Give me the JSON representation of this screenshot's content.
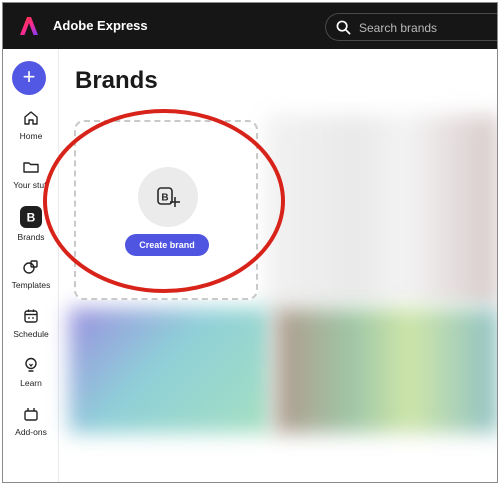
{
  "app": {
    "title": "Adobe Express",
    "brand_color": "#ff1a1a"
  },
  "search": {
    "placeholder": "Search brands"
  },
  "sidebar": {
    "create_label": "+",
    "items": [
      {
        "label": "Home",
        "icon": "home-icon"
      },
      {
        "label": "Your stuff",
        "icon": "folder-icon"
      },
      {
        "label": "Brands",
        "icon": "brand-icon",
        "active": true
      },
      {
        "label": "Templates",
        "icon": "templates-icon"
      },
      {
        "label": "Schedule",
        "icon": "calendar-icon"
      },
      {
        "label": "Learn",
        "icon": "lightbulb-icon"
      },
      {
        "label": "Add-ons",
        "icon": "addons-icon"
      }
    ]
  },
  "main": {
    "title": "Brands",
    "create_card": {
      "button_label": "Create brand",
      "icon": "add-brand-icon"
    }
  },
  "colors": {
    "accent": "#5258e4",
    "annotation": "#d8231a"
  }
}
